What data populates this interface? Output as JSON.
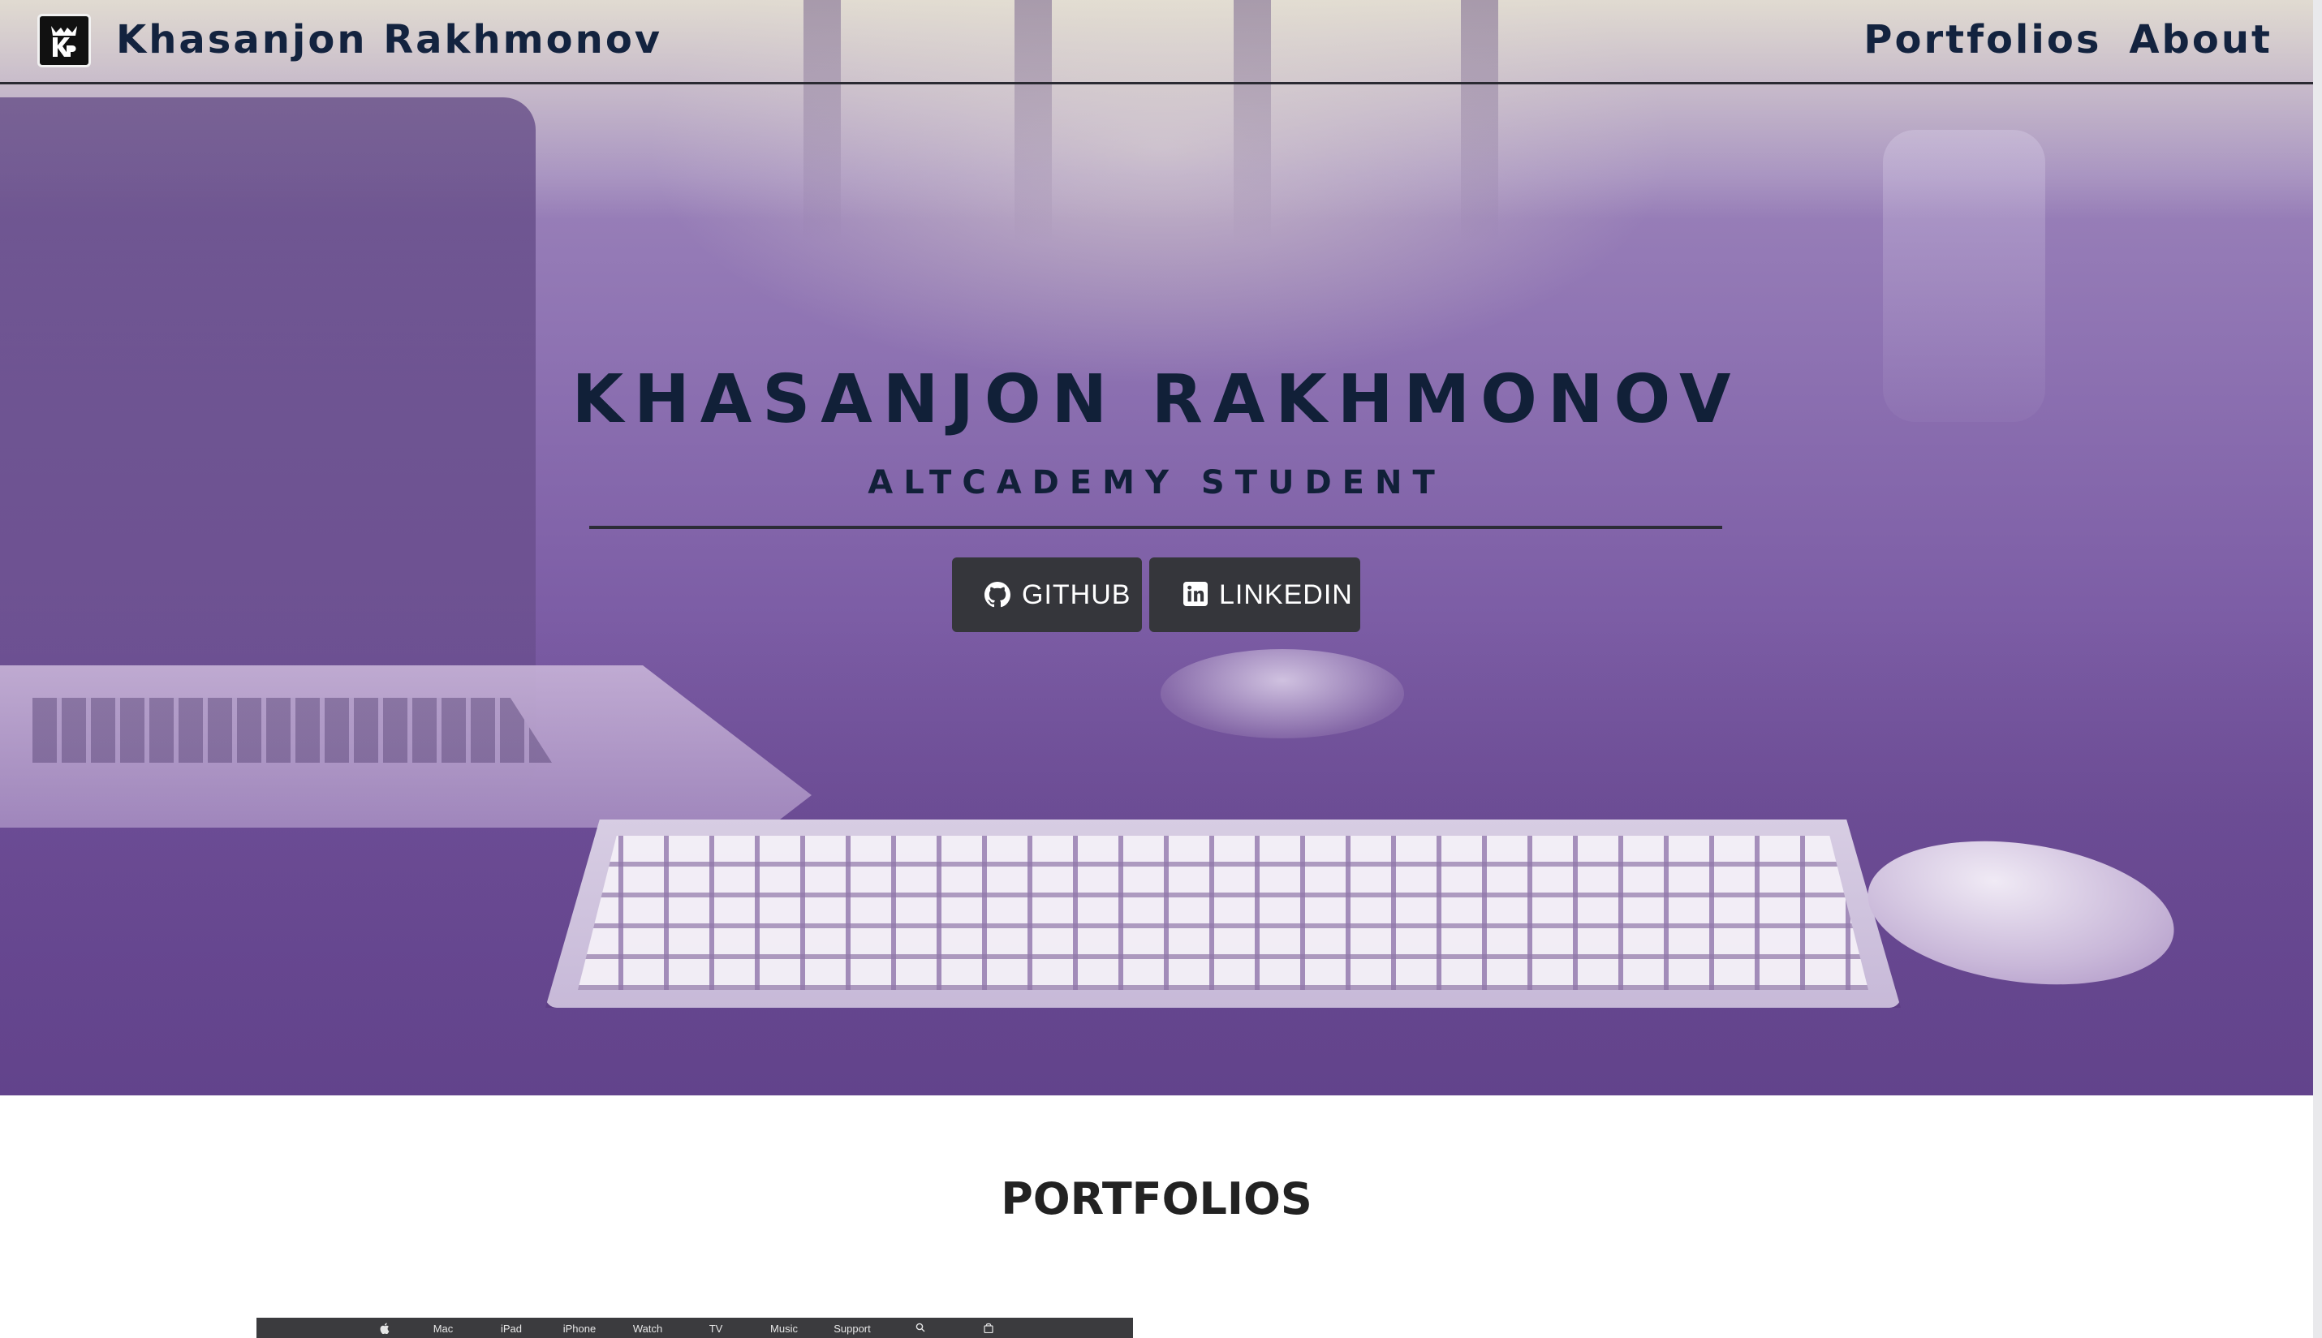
{
  "navbar": {
    "brand_name": "Khasanjon Rakhmonov",
    "logo_icon": "kr-monogram-icon",
    "links": [
      {
        "label": "Portfolios"
      },
      {
        "label": "About"
      }
    ]
  },
  "hero": {
    "title": "KHASANJON RAKHMONOV",
    "subtitle": "ALTCADEMY STUDENT",
    "buttons": [
      {
        "label": "GITHUB",
        "icon": "github-icon"
      },
      {
        "label": "LINKEDIN",
        "icon": "linkedin-icon"
      }
    ]
  },
  "portfolios": {
    "title": "PORTFOLIOS",
    "thumbnail_nav": [
      "",
      "Mac",
      "iPad",
      "iPhone",
      "Watch",
      "TV",
      "Music",
      "Support",
      "",
      ""
    ]
  },
  "colors": {
    "heading_navy": "#13233f",
    "button_bg": "#35363b",
    "hero_overlay_purple": "#7d5ea6"
  }
}
